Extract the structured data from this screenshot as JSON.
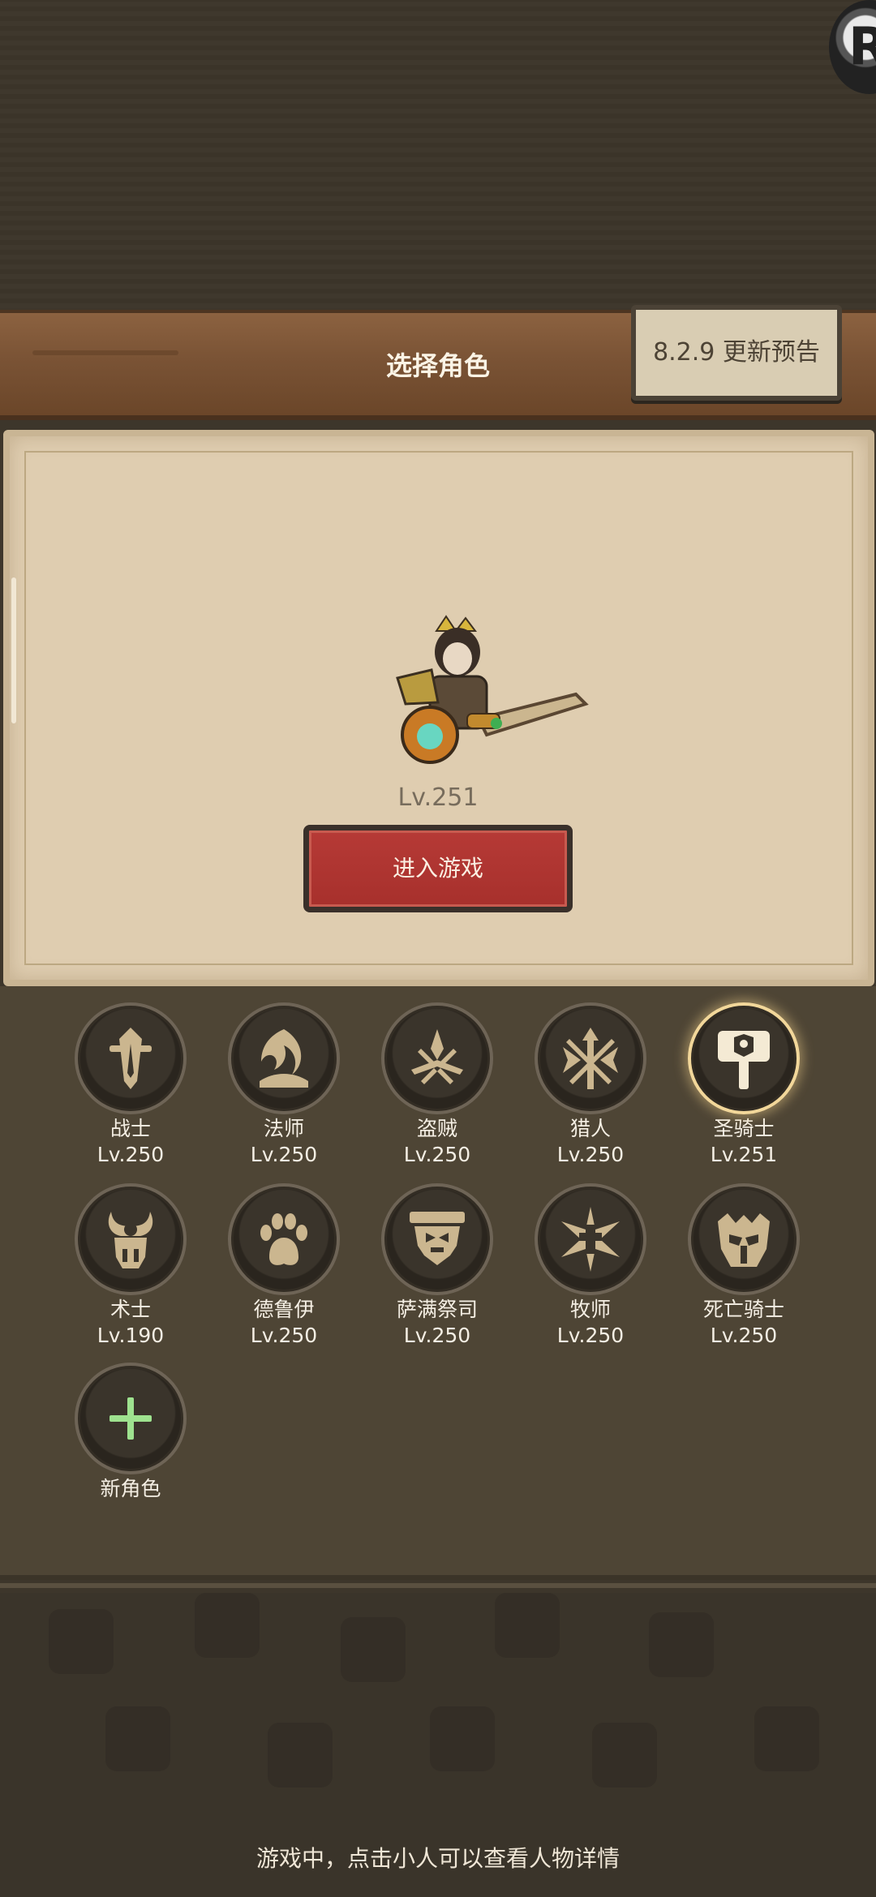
{
  "header": {
    "title": "选择角色",
    "version_notice": "8.2.9 更新预告"
  },
  "hero": {
    "level": "Lv.251",
    "enter_label": "进入游戏"
  },
  "characters": [
    {
      "name": "战士",
      "level": "Lv.250",
      "icon": "warrior-icon",
      "selected": false
    },
    {
      "name": "法师",
      "level": "Lv.250",
      "icon": "mage-icon",
      "selected": false
    },
    {
      "name": "盗贼",
      "level": "Lv.250",
      "icon": "rogue-icon",
      "selected": false
    },
    {
      "name": "猎人",
      "level": "Lv.250",
      "icon": "hunter-icon",
      "selected": false
    },
    {
      "name": "圣骑士",
      "level": "Lv.251",
      "icon": "paladin-icon",
      "selected": true
    },
    {
      "name": "术士",
      "level": "Lv.190",
      "icon": "warlock-icon",
      "selected": false
    },
    {
      "name": "德鲁伊",
      "level": "Lv.250",
      "icon": "druid-icon",
      "selected": false
    },
    {
      "name": "萨满祭司",
      "level": "Lv.250",
      "icon": "shaman-icon",
      "selected": false
    },
    {
      "name": "牧师",
      "level": "Lv.250",
      "icon": "priest-icon",
      "selected": false
    },
    {
      "name": "死亡骑士",
      "level": "Lv.250",
      "icon": "death-knight-icon",
      "selected": false
    }
  ],
  "new_character": {
    "label": "新角色",
    "icon": "plus-icon"
  },
  "footer": {
    "tip": "游戏中，点击小人可以查看人物详情"
  },
  "colors": {
    "accent_red": "#b13531",
    "icon_tan": "#cbb68f",
    "selected_glow": "#f2d79a",
    "plus_green": "#9ee28f"
  }
}
